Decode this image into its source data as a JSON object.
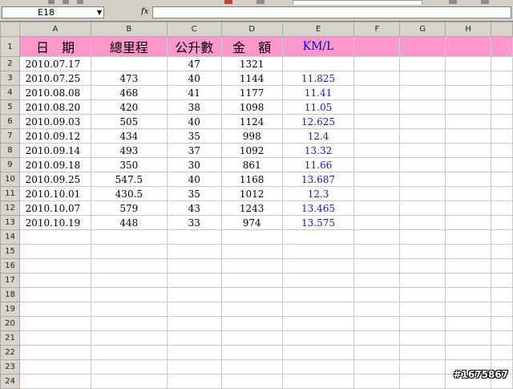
{
  "formula_bar": {
    "name_box": "E18",
    "fx_symbol": "fx",
    "formula": ""
  },
  "columns": [
    "A",
    "B",
    "C",
    "D",
    "E",
    "F",
    "G",
    "H"
  ],
  "header_row": {
    "row_number": "1",
    "cells": [
      "日　期",
      "總里程",
      "公升數",
      "金　額",
      "KM/L"
    ]
  },
  "rows": [
    {
      "row": "2",
      "date": "2010.07.17",
      "distance": "",
      "liters": "47",
      "amount": "1321",
      "kml": ""
    },
    {
      "row": "3",
      "date": "2010.07.25",
      "distance": "473",
      "liters": "40",
      "amount": "1144",
      "kml": "11.825"
    },
    {
      "row": "4",
      "date": "2010.08.08",
      "distance": "468",
      "liters": "41",
      "amount": "1177",
      "kml": "11.41"
    },
    {
      "row": "5",
      "date": "2010.08.20",
      "distance": "420",
      "liters": "38",
      "amount": "1098",
      "kml": "11.05"
    },
    {
      "row": "6",
      "date": "2010.09.03",
      "distance": "505",
      "liters": "40",
      "amount": "1124",
      "kml": "12.625"
    },
    {
      "row": "7",
      "date": "2010.09.12",
      "distance": "434",
      "liters": "35",
      "amount": "998",
      "kml": "12.4"
    },
    {
      "row": "8",
      "date": "2010.09.14",
      "distance": "493",
      "liters": "37",
      "amount": "1092",
      "kml": "13.32"
    },
    {
      "row": "9",
      "date": "2010.09.18",
      "distance": "350",
      "liters": "30",
      "amount": "861",
      "kml": "11.66"
    },
    {
      "row": "10",
      "date": "2010.09.25",
      "distance": "547.5",
      "liters": "40",
      "amount": "1168",
      "kml": "13.687"
    },
    {
      "row": "11",
      "date": "2010.10.01",
      "distance": "430.5",
      "liters": "35",
      "amount": "1012",
      "kml": "12.3"
    },
    {
      "row": "12",
      "date": "2010.10.07",
      "distance": "579",
      "liters": "43",
      "amount": "1243",
      "kml": "13.465"
    },
    {
      "row": "13",
      "date": "2010.10.19",
      "distance": "448",
      "liters": "33",
      "amount": "974",
      "kml": "13.575"
    }
  ],
  "empty_rows": [
    "14",
    "15",
    "16",
    "17",
    "18",
    "19",
    "20",
    "21",
    "22",
    "23",
    "24"
  ],
  "watermark": "#1675867",
  "colors": {
    "header_fill": "#ff99cc",
    "kml_text": "#0000cc"
  }
}
